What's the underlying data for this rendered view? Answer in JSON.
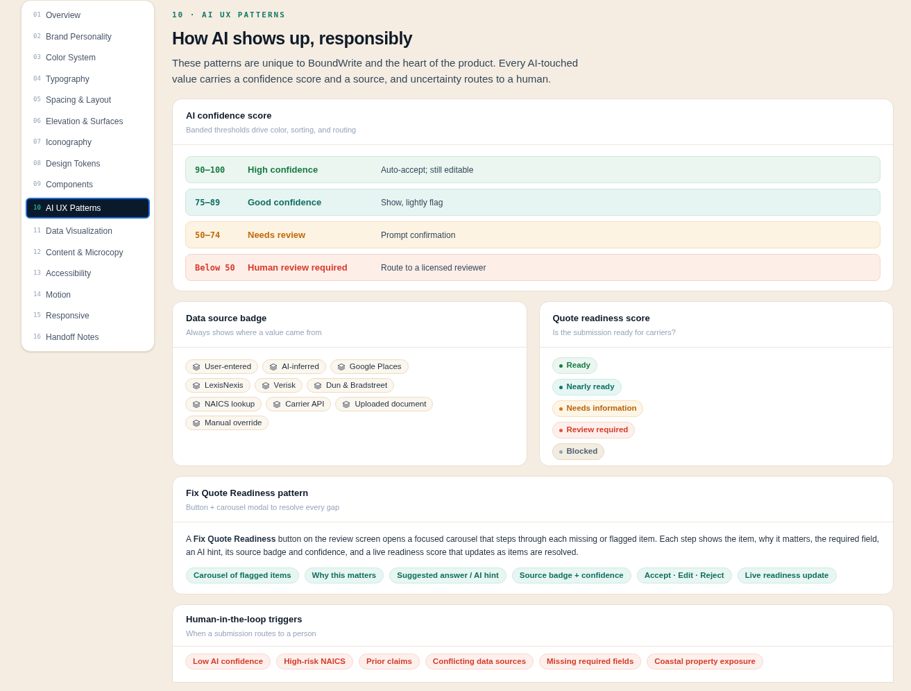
{
  "sidebar": {
    "items": [
      {
        "number": "01",
        "label": "Overview",
        "selected": false
      },
      {
        "number": "02",
        "label": "Brand Personality",
        "selected": false
      },
      {
        "number": "03",
        "label": "Color System",
        "selected": false
      },
      {
        "number": "04",
        "label": "Typography",
        "selected": false
      },
      {
        "number": "05",
        "label": "Spacing & Layout",
        "selected": false
      },
      {
        "number": "06",
        "label": "Elevation & Surfaces",
        "selected": false
      },
      {
        "number": "07",
        "label": "Iconography",
        "selected": false
      },
      {
        "number": "08",
        "label": "Design Tokens",
        "selected": false
      },
      {
        "number": "09",
        "label": "Components",
        "selected": false
      },
      {
        "number": "10",
        "label": "AI UX Patterns",
        "selected": true
      },
      {
        "number": "11",
        "label": "Data Visualization",
        "selected": false
      },
      {
        "number": "12",
        "label": "Content & Microcopy",
        "selected": false
      },
      {
        "number": "13",
        "label": "Accessibility",
        "selected": false
      },
      {
        "number": "14",
        "label": "Motion",
        "selected": false
      },
      {
        "number": "15",
        "label": "Responsive",
        "selected": false
      },
      {
        "number": "16",
        "label": "Handoff Notes",
        "selected": false
      }
    ]
  },
  "header": {
    "eyebrow": "10 · AI UX PATTERNS",
    "title": "How AI shows up, responsibly",
    "intro": "These patterns are unique to BoundWrite and the heart of the product. Every AI-touched value carries a confidence score and a source, and uncertainty routes to a human."
  },
  "confidence_card": {
    "title": "AI confidence score",
    "subtitle": "Banded thresholds drive color, sorting, and routing",
    "rows": [
      {
        "kind": "high",
        "range": "90–100",
        "label": "High confidence",
        "action": "Auto-accept; still editable"
      },
      {
        "kind": "good",
        "range": "75–89",
        "label": "Good confidence",
        "action": "Show, lightly flag"
      },
      {
        "kind": "review",
        "range": "50–74",
        "label": "Needs review",
        "action": "Prompt confirmation"
      },
      {
        "kind": "human",
        "range": "Below 50",
        "label": "Human review required",
        "action": "Route to a licensed reviewer"
      }
    ]
  },
  "source_card": {
    "title": "Data source badge",
    "subtitle": "Always shows where a value came from",
    "badges": [
      "User-entered",
      "AI-inferred",
      "Google Places",
      "LexisNexis",
      "Verisk",
      "Dun & Bradstreet",
      "NAICS lookup",
      "Carrier API",
      "Uploaded document",
      "Manual override"
    ]
  },
  "readiness_card": {
    "title": "Quote readiness score",
    "subtitle": "Is the submission ready for carriers?",
    "statuses": [
      {
        "kind": "ready",
        "label": "Ready",
        "color": "#15803d"
      },
      {
        "kind": "nearly",
        "label": "Nearly ready",
        "color": "#0f766e"
      },
      {
        "kind": "info",
        "label": "Needs information",
        "color": "#d97706"
      },
      {
        "kind": "review",
        "label": "Review required",
        "color": "#e5533d"
      },
      {
        "kind": "blocked",
        "label": "Blocked",
        "color": "#94a3b8"
      }
    ]
  },
  "fix_card": {
    "title": "Fix Quote Readiness pattern",
    "subtitle": "Button + carousel modal to resolve every gap",
    "body": "A **Fix Quote Readiness** button on the review screen opens a focused carousel that steps through each missing or flagged item. Each step shows the item, why it matters, the required field, an AI hint, its source badge and confidence, and a live readiness score that updates as items are resolved.",
    "chips": [
      "Carousel of flagged items",
      "Why this matters",
      "Suggested answer / AI hint",
      "Source badge + confidence",
      "Accept · Edit · Reject",
      "Live readiness update"
    ]
  },
  "hitl_card": {
    "title": "Human-in-the-loop triggers",
    "subtitle": "When a submission routes to a person",
    "chips": [
      "Low AI confidence",
      "High-risk NAICS",
      "Prior claims",
      "Conflicting data sources",
      "Missing required fields",
      "Coastal property exposure"
    ]
  }
}
